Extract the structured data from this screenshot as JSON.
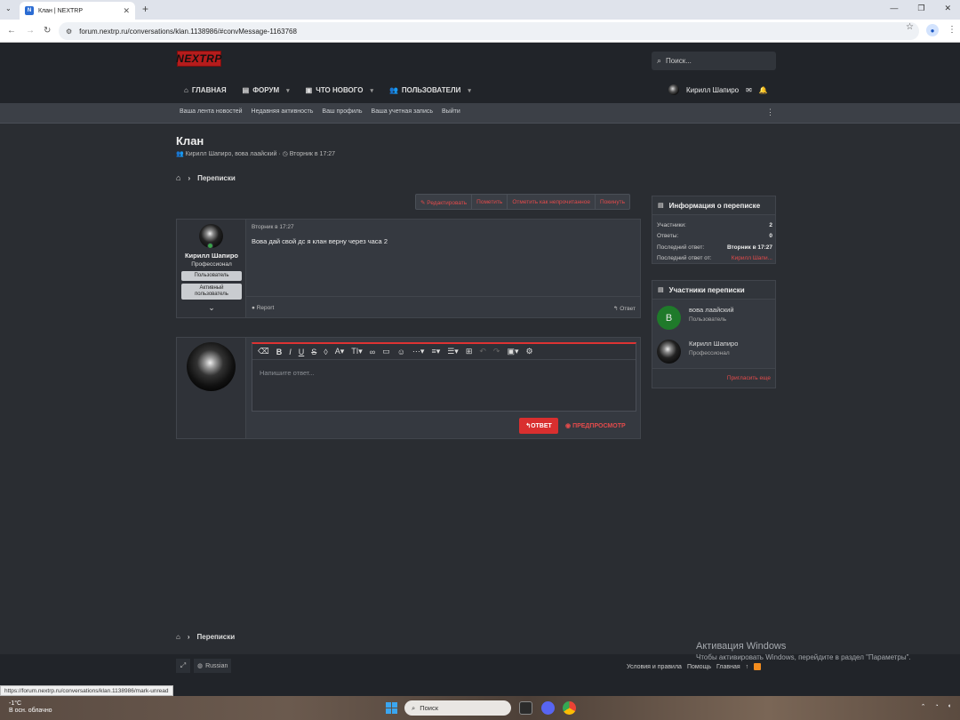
{
  "browser": {
    "tab_title": "Клан | NEXTRP",
    "favicon_letter": "N",
    "url": "forum.nextrp.ru/conversations/klan.1138986/#convMessage-1163768",
    "status_url": "https://forum.nextrp.ru/conversations/klan.1138986/mark-unread"
  },
  "header": {
    "logo": "NEXTRP",
    "search_placeholder": "Поиск...",
    "nav": [
      {
        "label": "ГЛАВНАЯ",
        "icon": "home-icon"
      },
      {
        "label": "ФОРУМ",
        "icon": "forum-icon"
      },
      {
        "label": "ЧТО НОВОГО",
        "icon": "news-icon"
      },
      {
        "label": "ПОЛЬЗОВАТЕЛИ",
        "icon": "users-icon"
      }
    ],
    "username": "Кирилл Шапиро"
  },
  "subnav": [
    "Ваша лента новостей",
    "Недавняя активность",
    "Ваш профиль",
    "Ваша учетная запись",
    "Выйти"
  ],
  "page": {
    "title": "Клан",
    "meta_participants": "Кирилл Шапиро, вова лаайский",
    "meta_sep": "·",
    "meta_date": "Вторник в 17:27",
    "breadcrumb": "Переписки"
  },
  "actions": [
    "Редактировать",
    "Пометить",
    "Отметить как непрочитанное",
    "Покинуть"
  ],
  "message": {
    "author": "Кирилл Шапиро",
    "user_title": "Профессионал",
    "banner1": "Пользователь",
    "banner2": "Активный пользователь",
    "date": "Вторник в 17:27",
    "text": "Вова дай свой дс я клан верну через часа 2",
    "report": "Report",
    "reply": "Ответ"
  },
  "composer": {
    "placeholder": "Напишите ответ...",
    "reply_button": "ОТВЕТ",
    "preview_button": "ПРЕДПРОСМОТР"
  },
  "info": {
    "title": "Информация о переписке",
    "rows": [
      {
        "k": "Участники:",
        "v": "2"
      },
      {
        "k": "Ответы:",
        "v": "0"
      },
      {
        "k": "Последний ответ:",
        "v": "Вторник в 17:27"
      },
      {
        "k": "Последний ответ от:",
        "v": "Кирилл Шапи..."
      }
    ]
  },
  "participants": {
    "title": "Участники переписки",
    "list": [
      {
        "name": "вова лаайский",
        "title": "Пользователь",
        "initial": "В"
      },
      {
        "name": "Кирилл Шапиро",
        "title": "Профессионал"
      }
    ],
    "invite": "Пригласить еще"
  },
  "footer": {
    "language": "Russian",
    "links": [
      "Условия и правила",
      "Помощь",
      "Главная"
    ]
  },
  "watermark": {
    "line1": "Активация Windows",
    "line2": "Чтобы активировать Windows, перейдите в раздел \"Параметры\"."
  },
  "taskbar": {
    "weather_temp": "-1°C",
    "weather_desc": "В осн. облачно",
    "search": "Поиск"
  },
  "colors": {
    "accent": "#e34b4b",
    "button": "#d92f2f",
    "online": "#3aa34a",
    "avatar_b": "#1f7a2a"
  }
}
